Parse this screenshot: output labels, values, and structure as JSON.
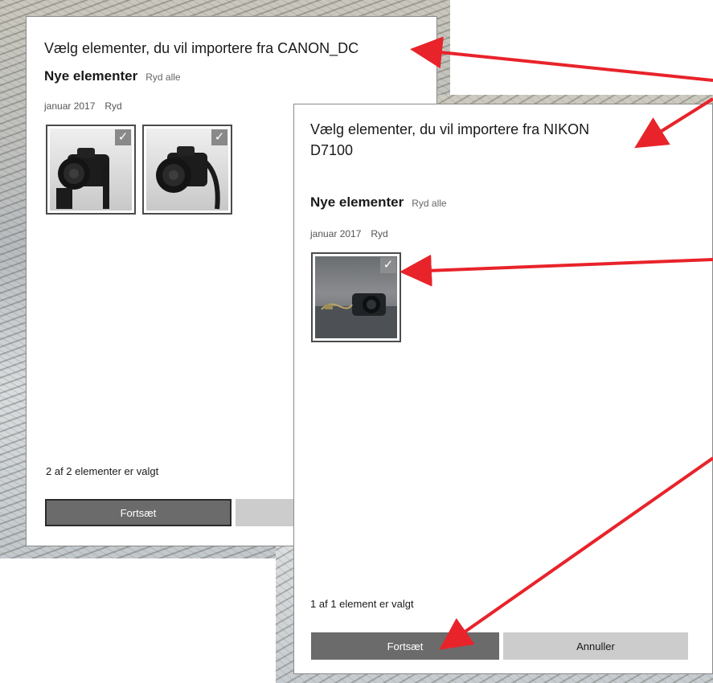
{
  "back_dialog": {
    "title": "Vælg elementer, du vil importere fra CANON_DC",
    "section_title": "Nye elementer",
    "clear_all": "Ryd alle",
    "group_date": "januar 2017",
    "group_clear": "Ryd",
    "status": "2 af 2 elementer er valgt",
    "continue_label": "Fortsæt"
  },
  "front_dialog": {
    "title_line1": "Vælg elementer, du vil importere fra NIKON",
    "title_line2": "D7100",
    "section_title": "Nye elementer",
    "clear_all": "Ryd alle",
    "group_date": "januar 2017",
    "group_clear": "Ryd",
    "status": "1 af 1 element er valgt",
    "continue_label": "Fortsæt",
    "cancel_label": "Annuller"
  },
  "checkmark": "✓",
  "icons": [
    "checkmark-icon",
    "camera-photo"
  ],
  "colors": {
    "primary_button": "#6b6b6b",
    "secondary_button": "#cccccc",
    "annotation_arrow": "#e8232a"
  }
}
